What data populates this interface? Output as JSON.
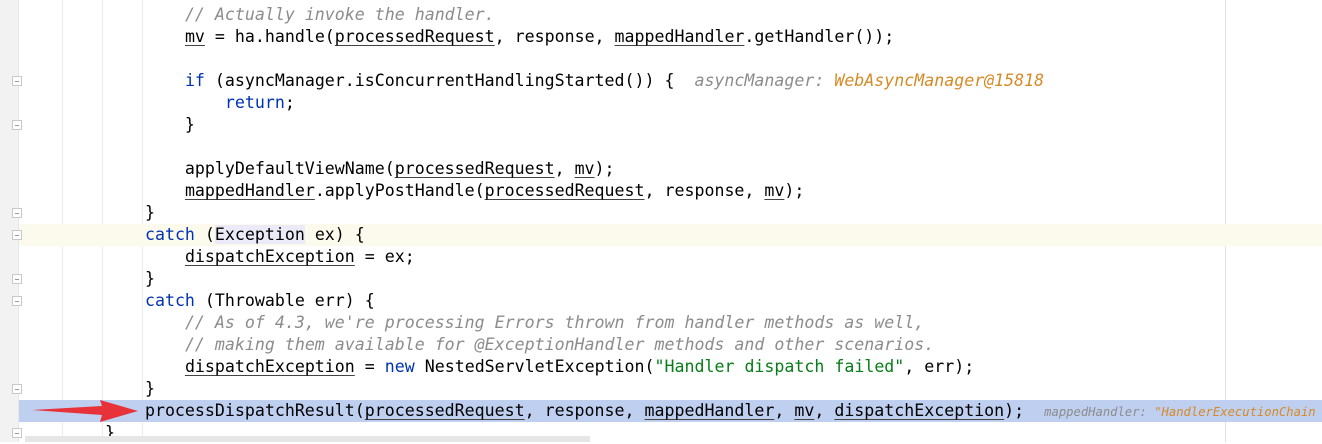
{
  "colors": {
    "keyword": "#0033b3",
    "comment": "#8c8c8c",
    "string": "#067d17",
    "hint_value": "#d68a26",
    "execution_line": "#bfcff0",
    "caret_line": "#fcfaed",
    "arrow": "#e8323a"
  },
  "code": {
    "lines": [
      {
        "tokens": [
          {
            "t": "        ",
            "c": ""
          },
          {
            "t": "// Actually invoke the handler.",
            "c": "cm"
          }
        ]
      },
      {
        "tokens": [
          {
            "t": "        ",
            "c": ""
          },
          {
            "t": "mv",
            "c": "u"
          },
          {
            "t": " = ha.handle(",
            "c": ""
          },
          {
            "t": "processedRequest",
            "c": "u"
          },
          {
            "t": ", response, ",
            "c": ""
          },
          {
            "t": "mappedHandler",
            "c": "u"
          },
          {
            "t": ".getHandler());",
            "c": ""
          }
        ]
      },
      {
        "tokens": []
      },
      {
        "tokens": [
          {
            "t": "        ",
            "c": ""
          },
          {
            "t": "if",
            "c": "kw"
          },
          {
            "t": " (asyncManager.isConcurrentHandlingStarted()) {  ",
            "c": ""
          },
          {
            "t": "asyncManager: ",
            "c": "hint"
          },
          {
            "t": "WebAsyncManager@15818",
            "c": "hintv"
          }
        ]
      },
      {
        "tokens": [
          {
            "t": "            ",
            "c": ""
          },
          {
            "t": "return",
            "c": "kw"
          },
          {
            "t": ";",
            "c": ""
          }
        ]
      },
      {
        "tokens": [
          {
            "t": "        }",
            "c": ""
          }
        ]
      },
      {
        "tokens": []
      },
      {
        "tokens": [
          {
            "t": "        applyDefaultViewName(",
            "c": ""
          },
          {
            "t": "processedRequest",
            "c": "u"
          },
          {
            "t": ", ",
            "c": ""
          },
          {
            "t": "mv",
            "c": "u"
          },
          {
            "t": ");",
            "c": ""
          }
        ]
      },
      {
        "tokens": [
          {
            "t": "        ",
            "c": ""
          },
          {
            "t": "mappedHandler",
            "c": "u"
          },
          {
            "t": ".applyPostHandle(",
            "c": ""
          },
          {
            "t": "processedRequest",
            "c": "u"
          },
          {
            "t": ", response, ",
            "c": ""
          },
          {
            "t": "mv",
            "c": "u"
          },
          {
            "t": ");",
            "c": ""
          }
        ]
      },
      {
        "tokens": [
          {
            "t": "    }",
            "c": ""
          }
        ]
      },
      {
        "tokens": [
          {
            "t": "    ",
            "c": ""
          },
          {
            "t": "catch",
            "c": "kw"
          },
          {
            "t": " (",
            "c": ""
          },
          {
            "t": "Exception",
            "c": "sel"
          },
          {
            "t": " ex) {",
            "c": ""
          }
        ]
      },
      {
        "tokens": [
          {
            "t": "        ",
            "c": ""
          },
          {
            "t": "dispatchException",
            "c": "u"
          },
          {
            "t": " = ex;",
            "c": ""
          }
        ]
      },
      {
        "tokens": [
          {
            "t": "    }",
            "c": ""
          }
        ]
      },
      {
        "tokens": [
          {
            "t": "    ",
            "c": ""
          },
          {
            "t": "catch",
            "c": "kw"
          },
          {
            "t": " (Throwable err) {",
            "c": ""
          }
        ]
      },
      {
        "tokens": [
          {
            "t": "        ",
            "c": ""
          },
          {
            "t": "// As of 4.3, we're processing Errors thrown from handler methods as well,",
            "c": "cm"
          }
        ]
      },
      {
        "tokens": [
          {
            "t": "        ",
            "c": ""
          },
          {
            "t": "// making them available for @ExceptionHandler methods and other scenarios.",
            "c": "cm"
          }
        ]
      },
      {
        "tokens": [
          {
            "t": "        ",
            "c": ""
          },
          {
            "t": "dispatchException",
            "c": "u"
          },
          {
            "t": " = ",
            "c": ""
          },
          {
            "t": "new",
            "c": "kw"
          },
          {
            "t": " NestedServletException(",
            "c": ""
          },
          {
            "t": "\"Handler dispatch failed\"",
            "c": "str"
          },
          {
            "t": ", err);",
            "c": ""
          }
        ]
      },
      {
        "tokens": [
          {
            "t": "    }",
            "c": ""
          }
        ]
      },
      {
        "tokens": [
          {
            "t": "    processDispatchResult(",
            "c": ""
          },
          {
            "t": "processedRequest",
            "c": "u"
          },
          {
            "t": ", response, ",
            "c": ""
          },
          {
            "t": "mappedHandler",
            "c": "u"
          },
          {
            "t": ", ",
            "c": ""
          },
          {
            "t": "mv",
            "c": "u"
          },
          {
            "t": ", ",
            "c": ""
          },
          {
            "t": "dispatchException",
            "c": "u"
          },
          {
            "t": ");  ",
            "c": ""
          },
          {
            "t": "mappedHandler: ",
            "c": "hint"
          },
          {
            "t": "\"HandlerExecutionChain",
            "c": "hintv"
          }
        ]
      },
      {
        "tokens": [
          {
            "t": "}",
            "c": ""
          }
        ]
      }
    ]
  }
}
